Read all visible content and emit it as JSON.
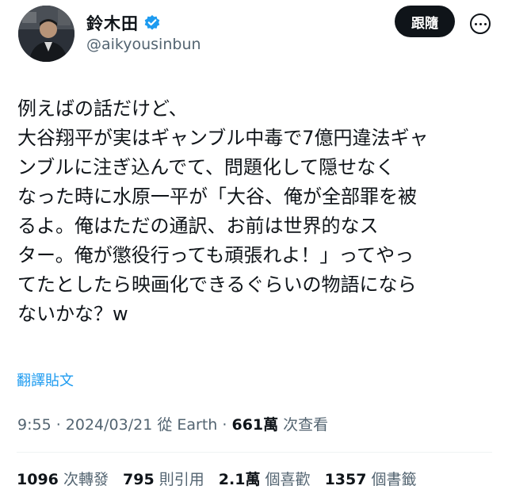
{
  "header": {
    "display_name": "鈴木田",
    "handle": "@aikyousinbun",
    "follow_label": "跟隨",
    "verified_color": "#1d9bf0"
  },
  "tweet": {
    "lines": [
      "例えばの話だけど、",
      "大谷翔平が実はギャンブル中毒で7億円違法ギャ",
      "ンブルに注ぎ込んでて、問題化して隠せなく",
      "なった時に水原一平が「大谷、俺が全部罪を被",
      "るよ。俺はただの通訳、お前は世界的なス",
      "ター。俺が懲役行っても頑張れよ！」ってやっ",
      "てたとしたら映画化できるぐらいの物語になら",
      "ないかな？w"
    ],
    "translate_label": "翻譯貼文"
  },
  "meta": {
    "time": "9:55",
    "sep1": " · ",
    "date": "2024/03/21",
    "from": " 從 Earth",
    "sep2": " · ",
    "views_count": "661萬",
    "views_label": " 次查看"
  },
  "stats": {
    "retweets_count": "1096",
    "retweets_label": "次轉發",
    "quotes_count": "795",
    "quotes_label": "則引用",
    "likes_count": "2.1萬",
    "likes_label": "個喜歡",
    "bookmarks_count": "1357",
    "bookmarks_label": "個書籤"
  }
}
